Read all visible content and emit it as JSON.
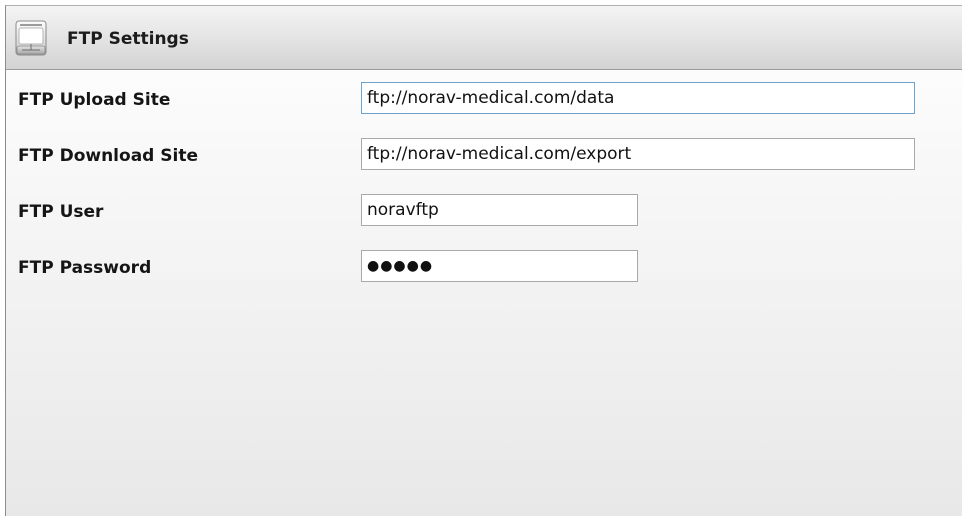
{
  "header": {
    "title": "FTP Settings",
    "icon": "ftp-drive-icon"
  },
  "fields": {
    "upload_site": {
      "label": "FTP Upload Site",
      "value": "ftp://norav-medical.com/data"
    },
    "download_site": {
      "label": "FTP Download Site",
      "value": "ftp://norav-medical.com/export"
    },
    "user": {
      "label": "FTP User",
      "value": "noravftp"
    },
    "password": {
      "label": "FTP Password",
      "value": "●●●●●"
    }
  },
  "colors": {
    "focus_border": "#6fa3cf",
    "input_border": "#a9a9a9",
    "header_bottom": "#d3d3d3"
  }
}
